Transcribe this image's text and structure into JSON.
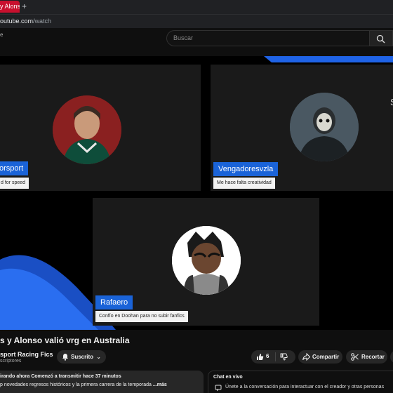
{
  "browser": {
    "tab_title": "y Alons",
    "new_tab_glyph": "+",
    "url_host": "outube.com",
    "url_path": "/watch"
  },
  "header": {
    "left_fragment": "e",
    "search_placeholder": "Buscar",
    "search_icon": "search-icon"
  },
  "video": {
    "accent_color": "#1a63d8",
    "side_letter": "S",
    "participants": [
      {
        "name": "orsport",
        "subtitle": "d for speed"
      },
      {
        "name": "Vengadoresvzla",
        "subtitle": "Me hace falta creatividad"
      },
      {
        "name": "Rafaero",
        "subtitle": "Confío en Doohan para no subir fanfics"
      }
    ]
  },
  "meta": {
    "title": "s y Alonso valió vrg en Australia",
    "channel": "sport Racing Fics",
    "subscribers": "scriptores",
    "subscribe_label": "Suscrito",
    "like_count": "6",
    "share_label": "Compartir",
    "clip_label": "Recortar"
  },
  "description": {
    "meta_line": "irando ahora  Comenzó a transmitir hace 37 minutos",
    "text_line": "p novedades regresos históricos y la primera carrera de la temporada ",
    "more": "...más"
  },
  "chat": {
    "header": "Chat en vivo",
    "message": "Únete a la conversación para interactuar con el creador y otras personas"
  }
}
